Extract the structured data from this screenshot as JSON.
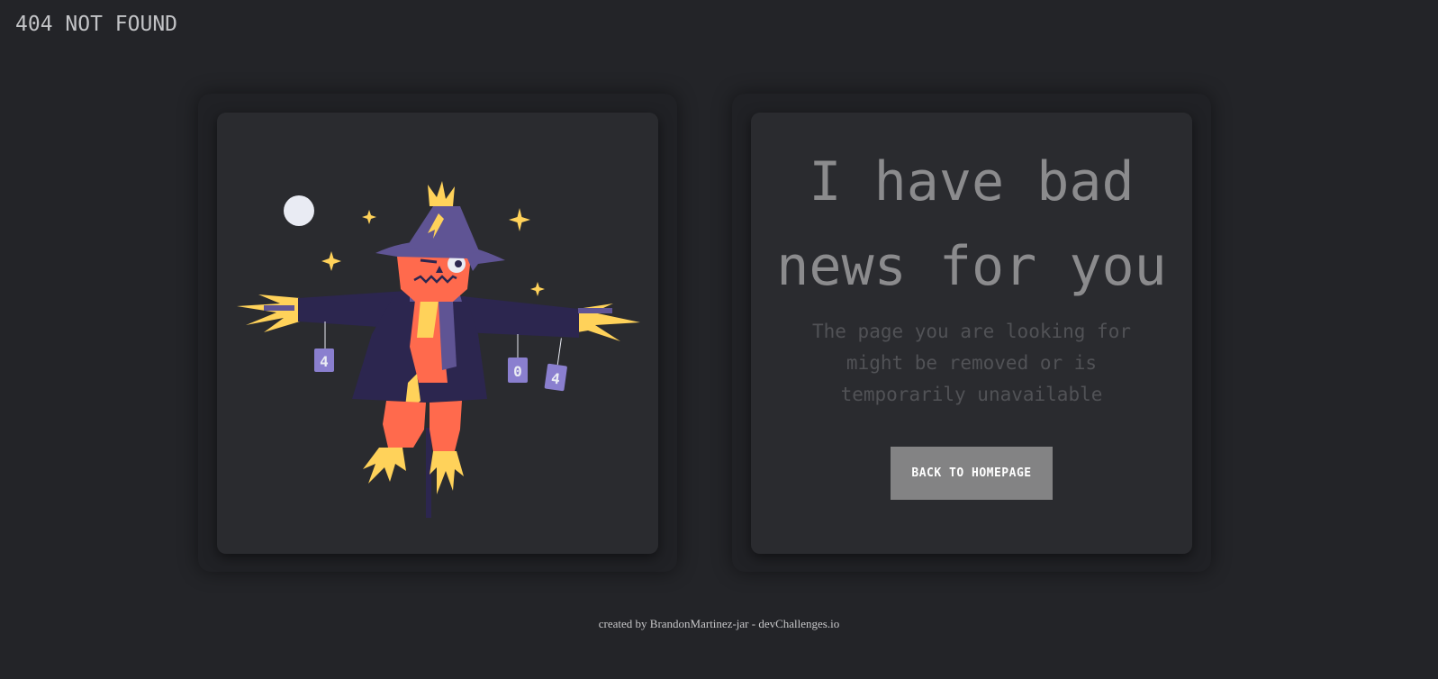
{
  "header": {
    "title": "404 NOT FOUND"
  },
  "illustration": {
    "subject": "scarecrow",
    "can_labels": [
      "4",
      "0",
      "4"
    ]
  },
  "main": {
    "headline_line1": "I have bad",
    "headline_line2": "news for you",
    "message_line1": "The page you are looking for",
    "message_line2": "might be removed or is",
    "message_line3": "temporarily unavailable",
    "button_label": "BACK TO HOMEPAGE"
  },
  "footer": {
    "text": "created by BrandonMartinez-jar - devChallenges.io"
  },
  "colors": {
    "background": "#232428",
    "card": "#2a2b2f",
    "button": "#838384",
    "scarecrow_body": "#ff6a4d",
    "scarecrow_coat": "#2c264f",
    "hat": "#5f5494",
    "straw": "#ffd25a",
    "moon": "#e9ebf3"
  }
}
